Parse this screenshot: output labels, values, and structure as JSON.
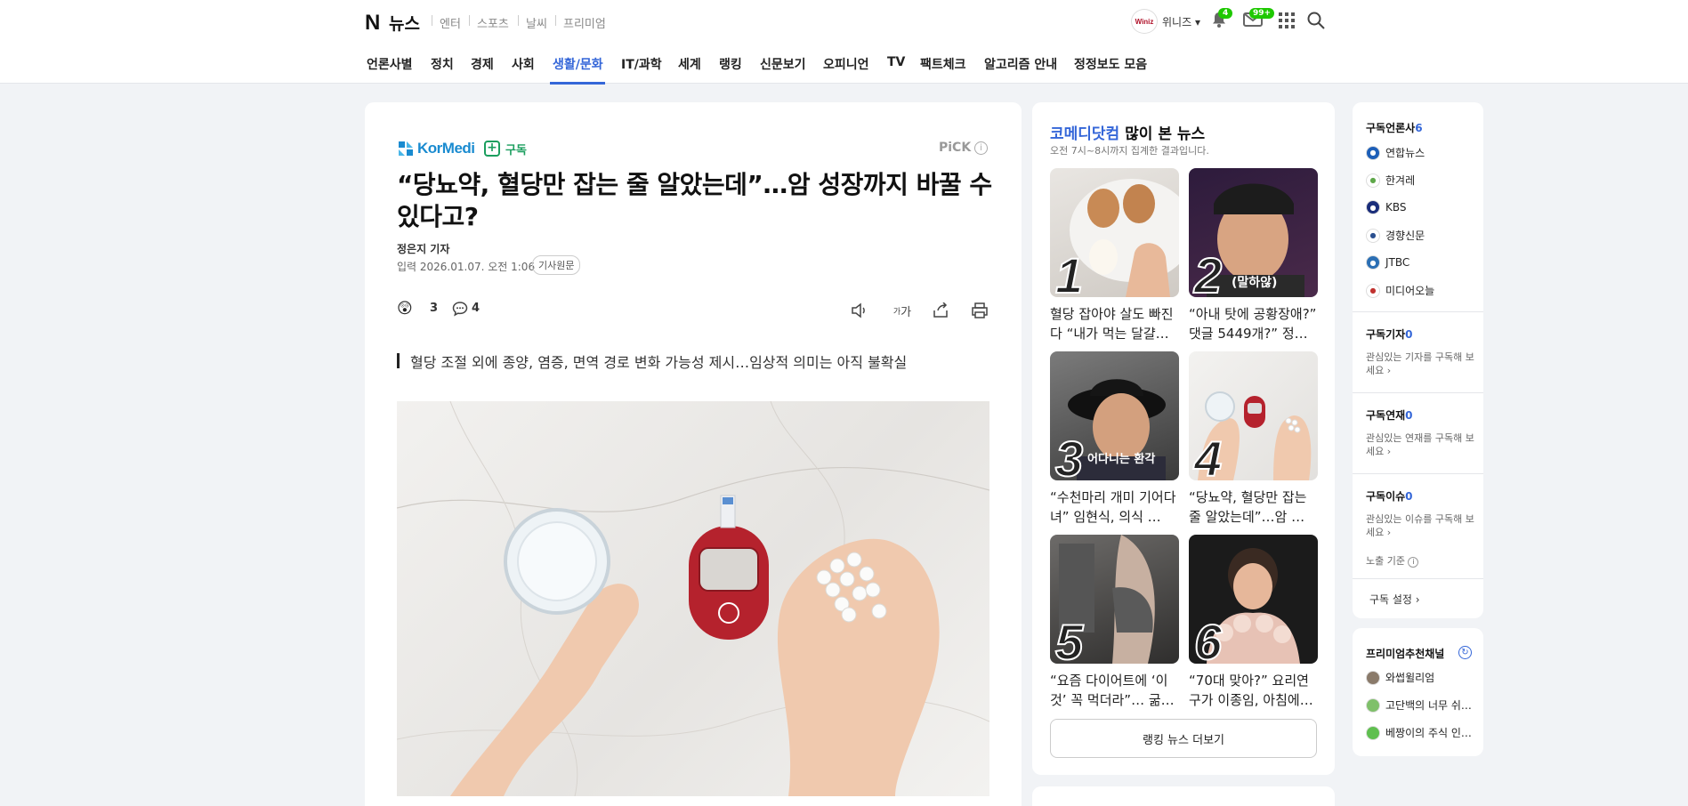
{
  "header": {
    "logo_n": "N",
    "logo_text": "뉴스",
    "services": [
      "엔터",
      "스포츠",
      "날씨",
      "프리미엄"
    ],
    "user_badge": "Winiz",
    "user_name": "위니즈",
    "notification_count": "4",
    "mail_count": "99+"
  },
  "gnb": {
    "items": [
      "언론사별",
      "정치",
      "경제",
      "사회",
      "생활/문화",
      "IT/과학",
      "세계",
      "랭킹",
      "신문보기",
      "오피니언",
      "TV",
      "팩트체크",
      "알고리즘 안내",
      "정정보도 모음"
    ],
    "active": "생활/문화"
  },
  "article": {
    "press": "KorMedi",
    "subscribe": "구독",
    "pick": "PiCK",
    "headline": "“당뇨약, 혈당만 잡는 줄 알았는데”…암 성장까지 바꿀 수 있다고?",
    "reporter": "정은지 기자",
    "date": "입력 2026.01.07. 오전 1:06",
    "original_link": "기사원문",
    "reaction_count": "3",
    "comment_count": "4",
    "font_size_label": "가",
    "summary": "혈당 조절 외에 종양, 염증, 면역 경로 변화 가능성 제시…임상적 의미는 아직 불확실"
  },
  "ranking": {
    "press": "코메디닷컴",
    "title_suffix": " 많이 본 뉴스",
    "subtitle": "오전 7시~8시까지 집계한 결과입니다.",
    "items": [
      {
        "rank": "1",
        "caption": "혈당 잡아야 살도 빠진다 “내가 먹는 달걀…"
      },
      {
        "rank": "2",
        "caption": "“아내 탓에 공황장애?” 댓글 5449개?” 정…"
      },
      {
        "rank": "3",
        "caption": "“수천마리 개미 기어다녀” 임현식, 의식 …"
      },
      {
        "rank": "4",
        "caption": "“당뇨약, 혈당만 잡는 줄 알았는데”…암 …"
      },
      {
        "rank": "5",
        "caption": "“요즘 다이어트에 ‘이것’ 꼭 먹더라”… 굶…"
      },
      {
        "rank": "6",
        "caption": "“70대 맞아?” 요리연구가 이종임, 아침에…"
      }
    ],
    "thumb2_text": "(말하않)",
    "thumb3_text": "어다니는 환각",
    "more": "랭킹 뉴스 더보기"
  },
  "subscriptions": {
    "press_label": "구독언론사",
    "press_count": "6",
    "press": [
      {
        "name": "연합뉴스",
        "color": "#1d5fb8"
      },
      {
        "name": "한겨레",
        "color": "#5fa84a"
      },
      {
        "name": "KBS",
        "color": "#1a2d7a"
      },
      {
        "name": "경향신문",
        "color": "#2a4f8f"
      },
      {
        "name": "JTBC",
        "color": "#2b6fb4"
      },
      {
        "name": "미디어오늘",
        "color": "#c0322f"
      }
    ],
    "reporter_label": "구독기자",
    "reporter_count": "0",
    "reporter_text": "관심있는 기자를 구독해 보세요 ›",
    "series_label": "구독연재",
    "series_count": "0",
    "series_text": "관심있는 연재를 구독해 보세요 ›",
    "issue_label": "구독이슈",
    "issue_count": "0",
    "issue_text": "관심있는 이슈를 구독해 보세요 ›",
    "exposure": "노출 기준",
    "settings": "구독 설정 ›"
  },
  "premium": {
    "title": "프리미엄추천채널",
    "channels": [
      "와썹윌리엄",
      "고단백의 너무 쉬…",
      "베짱이의 주식 인…"
    ]
  }
}
